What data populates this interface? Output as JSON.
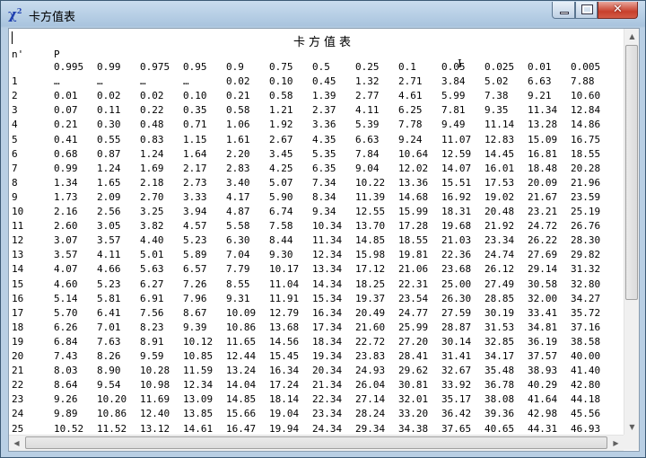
{
  "window": {
    "title": "卡方值表",
    "icon": "chi-square-icon",
    "close_glyph": "✕"
  },
  "table": {
    "title": "卡方值表",
    "row_header": "n'",
    "col_header": "P",
    "p_values": [
      "0.995",
      "0.99",
      "0.975",
      "0.95",
      "0.9",
      "0.75",
      "0.5",
      "0.25",
      "0.1",
      "0.05",
      "0.025",
      "0.01",
      "0.005"
    ],
    "rows": [
      [
        "1",
        "…",
        "…",
        "…",
        "…",
        "0.02",
        "0.10",
        "0.45",
        "1.32",
        "2.71",
        "3.84",
        "5.02",
        "6.63",
        "7.88"
      ],
      [
        "2",
        "0.01",
        "0.02",
        "0.02",
        "0.10",
        "0.21",
        "0.58",
        "1.39",
        "2.77",
        "4.61",
        "5.99",
        "7.38",
        "9.21",
        "10.60"
      ],
      [
        "3",
        "0.07",
        "0.11",
        "0.22",
        "0.35",
        "0.58",
        "1.21",
        "2.37",
        "4.11",
        "6.25",
        "7.81",
        "9.35",
        "11.34",
        "12.84"
      ],
      [
        "4",
        "0.21",
        "0.30",
        "0.48",
        "0.71",
        "1.06",
        "1.92",
        "3.36",
        "5.39",
        "7.78",
        "9.49",
        "11.14",
        "13.28",
        "14.86"
      ],
      [
        "5",
        "0.41",
        "0.55",
        "0.83",
        "1.15",
        "1.61",
        "2.67",
        "4.35",
        "6.63",
        "9.24",
        "11.07",
        "12.83",
        "15.09",
        "16.75"
      ],
      [
        "6",
        "0.68",
        "0.87",
        "1.24",
        "1.64",
        "2.20",
        "3.45",
        "5.35",
        "7.84",
        "10.64",
        "12.59",
        "14.45",
        "16.81",
        "18.55"
      ],
      [
        "7",
        "0.99",
        "1.24",
        "1.69",
        "2.17",
        "2.83",
        "4.25",
        "6.35",
        "9.04",
        "12.02",
        "14.07",
        "16.01",
        "18.48",
        "20.28"
      ],
      [
        "8",
        "1.34",
        "1.65",
        "2.18",
        "2.73",
        "3.40",
        "5.07",
        "7.34",
        "10.22",
        "13.36",
        "15.51",
        "17.53",
        "20.09",
        "21.96"
      ],
      [
        "9",
        "1.73",
        "2.09",
        "2.70",
        "3.33",
        "4.17",
        "5.90",
        "8.34",
        "11.39",
        "14.68",
        "16.92",
        "19.02",
        "21.67",
        "23.59"
      ],
      [
        "10",
        "2.16",
        "2.56",
        "3.25",
        "3.94",
        "4.87",
        "6.74",
        "9.34",
        "12.55",
        "15.99",
        "18.31",
        "20.48",
        "23.21",
        "25.19"
      ],
      [
        "11",
        "2.60",
        "3.05",
        "3.82",
        "4.57",
        "5.58",
        "7.58",
        "10.34",
        "13.70",
        "17.28",
        "19.68",
        "21.92",
        "24.72",
        "26.76"
      ],
      [
        "12",
        "3.07",
        "3.57",
        "4.40",
        "5.23",
        "6.30",
        "8.44",
        "11.34",
        "14.85",
        "18.55",
        "21.03",
        "23.34",
        "26.22",
        "28.30"
      ],
      [
        "13",
        "3.57",
        "4.11",
        "5.01",
        "5.89",
        "7.04",
        "9.30",
        "12.34",
        "15.98",
        "19.81",
        "22.36",
        "24.74",
        "27.69",
        "29.82"
      ],
      [
        "14",
        "4.07",
        "4.66",
        "5.63",
        "6.57",
        "7.79",
        "10.17",
        "13.34",
        "17.12",
        "21.06",
        "23.68",
        "26.12",
        "29.14",
        "31.32"
      ],
      [
        "15",
        "4.60",
        "5.23",
        "6.27",
        "7.26",
        "8.55",
        "11.04",
        "14.34",
        "18.25",
        "22.31",
        "25.00",
        "27.49",
        "30.58",
        "32.80"
      ],
      [
        "16",
        "5.14",
        "5.81",
        "6.91",
        "7.96",
        "9.31",
        "11.91",
        "15.34",
        "19.37",
        "23.54",
        "26.30",
        "28.85",
        "32.00",
        "34.27"
      ],
      [
        "17",
        "5.70",
        "6.41",
        "7.56",
        "8.67",
        "10.09",
        "12.79",
        "16.34",
        "20.49",
        "24.77",
        "27.59",
        "30.19",
        "33.41",
        "35.72"
      ],
      [
        "18",
        "6.26",
        "7.01",
        "8.23",
        "9.39",
        "10.86",
        "13.68",
        "17.34",
        "21.60",
        "25.99",
        "28.87",
        "31.53",
        "34.81",
        "37.16"
      ],
      [
        "19",
        "6.84",
        "7.63",
        "8.91",
        "10.12",
        "11.65",
        "14.56",
        "18.34",
        "22.72",
        "27.20",
        "30.14",
        "32.85",
        "36.19",
        "38.58"
      ],
      [
        "20",
        "7.43",
        "8.26",
        "9.59",
        "10.85",
        "12.44",
        "15.45",
        "19.34",
        "23.83",
        "28.41",
        "31.41",
        "34.17",
        "37.57",
        "40.00"
      ],
      [
        "21",
        "8.03",
        "8.90",
        "10.28",
        "11.59",
        "13.24",
        "16.34",
        "20.34",
        "24.93",
        "29.62",
        "32.67",
        "35.48",
        "38.93",
        "41.40"
      ],
      [
        "22",
        "8.64",
        "9.54",
        "10.98",
        "12.34",
        "14.04",
        "17.24",
        "21.34",
        "26.04",
        "30.81",
        "33.92",
        "36.78",
        "40.29",
        "42.80"
      ],
      [
        "23",
        "9.26",
        "10.20",
        "11.69",
        "13.09",
        "14.85",
        "18.14",
        "22.34",
        "27.14",
        "32.01",
        "35.17",
        "38.08",
        "41.64",
        "44.18"
      ],
      [
        "24",
        "9.89",
        "10.86",
        "12.40",
        "13.85",
        "15.66",
        "19.04",
        "23.34",
        "28.24",
        "33.20",
        "36.42",
        "39.36",
        "42.98",
        "45.56"
      ],
      [
        "25",
        "10.52",
        "11.52",
        "13.12",
        "14.61",
        "16.47",
        "19.94",
        "24.34",
        "29.34",
        "34.38",
        "37.65",
        "40.65",
        "44.31",
        "46.93"
      ]
    ]
  },
  "scrollbars": {
    "up_glyph": "▲",
    "down_glyph": "▼",
    "left_glyph": "◀",
    "right_glyph": "▶"
  }
}
